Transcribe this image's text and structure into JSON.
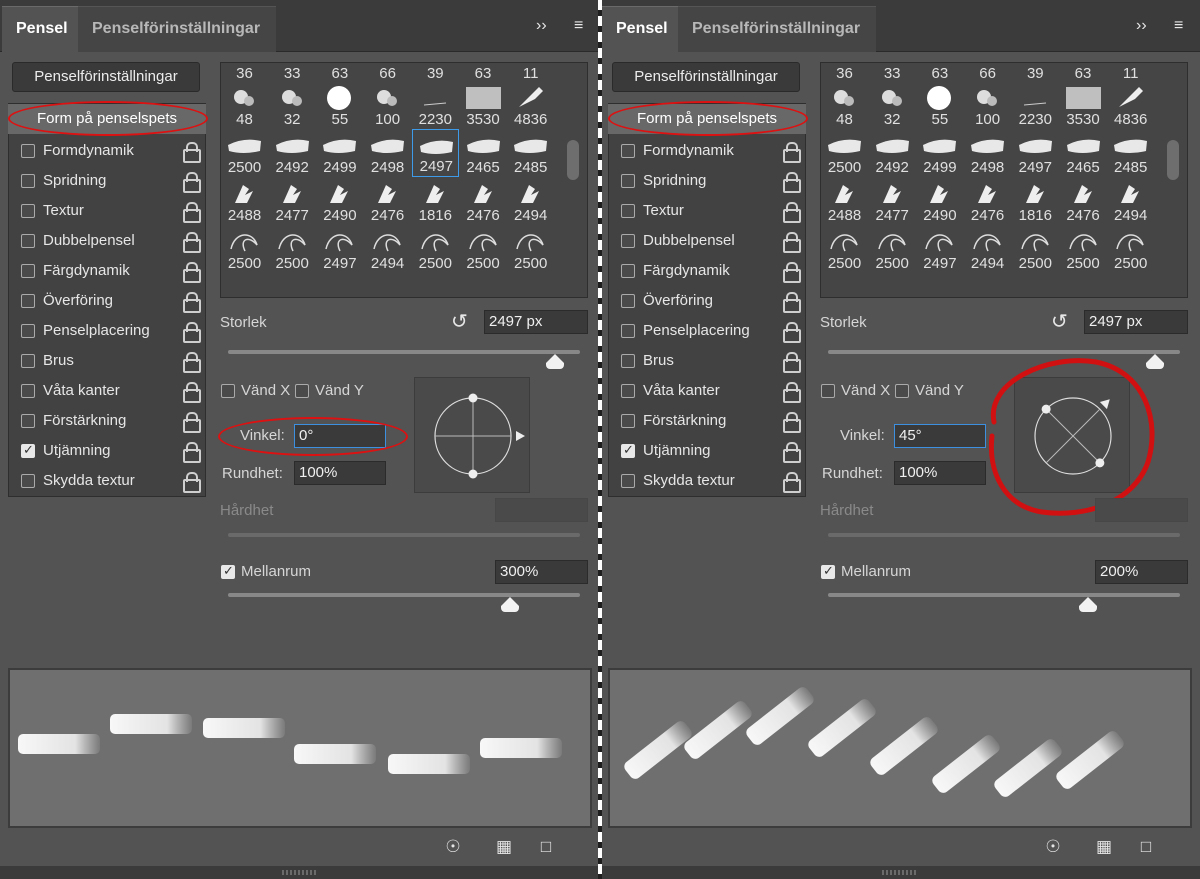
{
  "panels": [
    {
      "tabs": {
        "active": "Pensel",
        "inactive": "Penselförinställningar",
        "collapse_icon": "double-chevron-right-icon",
        "menu_icon": "hamburger-menu-icon"
      },
      "settings_button": "Penselförinställningar",
      "tip_shape_item": "Form på penselspets",
      "list_items": [
        {
          "label": "Formdynamik",
          "checked": false
        },
        {
          "label": "Spridning",
          "checked": false
        },
        {
          "label": "Textur",
          "checked": false
        },
        {
          "label": "Dubbelpensel",
          "checked": false
        },
        {
          "label": "Färgdynamik",
          "checked": false
        },
        {
          "label": "Överföring",
          "checked": false
        },
        {
          "label": "Penselplacering",
          "checked": false
        },
        {
          "label": "Brus",
          "checked": false
        },
        {
          "label": "Våta kanter",
          "checked": false
        },
        {
          "label": "Förstärkning",
          "checked": false
        },
        {
          "label": "Utjämning",
          "checked": true
        },
        {
          "label": "Skydda textur",
          "checked": false
        }
      ],
      "brush_grid": {
        "top_row": [
          "36",
          "33",
          "63",
          "66",
          "39",
          "63",
          "11"
        ],
        "rows": [
          [
            "48",
            "32",
            "55",
            "100",
            "2230",
            "3530",
            "4836"
          ],
          [
            "2500",
            "2492",
            "2499",
            "2498",
            "2497",
            "2465",
            "2485"
          ],
          [
            "2488",
            "2477",
            "2490",
            "2476",
            "1816",
            "2476",
            "2494"
          ],
          [
            "2500",
            "2500",
            "2497",
            "2494",
            "2500",
            "2500",
            "2500"
          ]
        ],
        "selected": "2497"
      },
      "size_label": "Storlek",
      "size_value": "2497 px",
      "size_fraction": 0.93,
      "flip_x": "Vänd X",
      "flip_y": "Vänd Y",
      "angle_label": "Vinkel:",
      "angle_value": "0°",
      "angle_degrees": 0,
      "roundness_label": "Rundhet:",
      "roundness_value": "100%",
      "hardness_label": "Hårdhet",
      "spacing_label": "Mellanrum",
      "spacing_checked": true,
      "spacing_value": "300%",
      "spacing_fraction": 0.8,
      "bottom_icons": [
        "eye-brush-icon",
        "grid-icon",
        "new-preset-icon"
      ]
    },
    {
      "tabs": {
        "active": "Pensel",
        "inactive": "Penselförinställningar",
        "collapse_icon": "double-chevron-right-icon",
        "menu_icon": "hamburger-menu-icon"
      },
      "settings_button": "Penselförinställningar",
      "tip_shape_item": "Form på penselspets",
      "list_items": [
        {
          "label": "Formdynamik",
          "checked": false
        },
        {
          "label": "Spridning",
          "checked": false
        },
        {
          "label": "Textur",
          "checked": false
        },
        {
          "label": "Dubbelpensel",
          "checked": false
        },
        {
          "label": "Färgdynamik",
          "checked": false
        },
        {
          "label": "Överföring",
          "checked": false
        },
        {
          "label": "Penselplacering",
          "checked": false
        },
        {
          "label": "Brus",
          "checked": false
        },
        {
          "label": "Våta kanter",
          "checked": false
        },
        {
          "label": "Förstärkning",
          "checked": false
        },
        {
          "label": "Utjämning",
          "checked": true
        },
        {
          "label": "Skydda textur",
          "checked": false
        }
      ],
      "brush_grid": {
        "top_row": [
          "36",
          "33",
          "63",
          "66",
          "39",
          "63",
          "11"
        ],
        "rows": [
          [
            "48",
            "32",
            "55",
            "100",
            "2230",
            "3530",
            "4836"
          ],
          [
            "2500",
            "2492",
            "2499",
            "2498",
            "2497",
            "2465",
            "2485"
          ],
          [
            "2488",
            "2477",
            "2490",
            "2476",
            "1816",
            "2476",
            "2494"
          ],
          [
            "2500",
            "2500",
            "2497",
            "2494",
            "2500",
            "2500",
            "2500"
          ]
        ],
        "selected": null
      },
      "size_label": "Storlek",
      "size_value": "2497 px",
      "size_fraction": 0.93,
      "flip_x": "Vänd X",
      "flip_y": "Vänd Y",
      "angle_label": "Vinkel:",
      "angle_value": "45°",
      "angle_degrees": 45,
      "roundness_label": "Rundhet:",
      "roundness_value": "100%",
      "hardness_label": "Hårdhet",
      "spacing_label": "Mellanrum",
      "spacing_checked": true,
      "spacing_value": "200%",
      "spacing_fraction": 0.74,
      "bottom_icons": [
        "eye-brush-icon",
        "grid-icon",
        "new-preset-icon"
      ]
    }
  ],
  "colors": {
    "panel_bg": "#535353",
    "accent_blue": "#3d9be9",
    "annotation_red": "#d11111"
  }
}
